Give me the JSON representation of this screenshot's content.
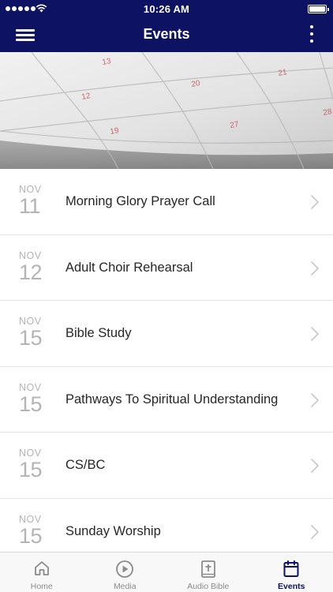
{
  "status_bar": {
    "time": "10:26 AM"
  },
  "nav": {
    "title": "Events"
  },
  "hero": {
    "calendar_numbers": [
      "20",
      "21",
      "12",
      "13",
      "19",
      "27",
      "28"
    ]
  },
  "events": [
    {
      "month": "NOV",
      "day": "11",
      "title": "Morning Glory Prayer Call"
    },
    {
      "month": "NOV",
      "day": "12",
      "title": "Adult Choir Rehearsal"
    },
    {
      "month": "NOV",
      "day": "15",
      "title": "Bible Study"
    },
    {
      "month": "NOV",
      "day": "15",
      "title": "Pathways To Spiritual Understanding"
    },
    {
      "month": "NOV",
      "day": "15",
      "title": "CS/BC"
    },
    {
      "month": "NOV",
      "day": "15",
      "title": "Sunday Worship"
    }
  ],
  "tabs": [
    {
      "label": "Home",
      "icon": "home-icon"
    },
    {
      "label": "Media",
      "icon": "play-circle-icon"
    },
    {
      "label": "Audio Bible",
      "icon": "bible-icon"
    },
    {
      "label": "Events",
      "icon": "calendar-icon",
      "active": true
    }
  ],
  "colors": {
    "nav_bg": "#0d1263",
    "active_tab": "#0d1263",
    "date_text": "#b4b4b4",
    "chevron": "#c7c7cc"
  }
}
